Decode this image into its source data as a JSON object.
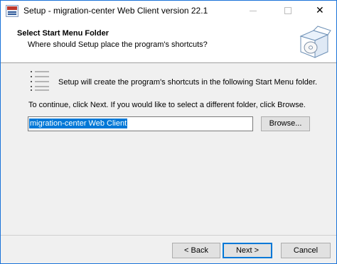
{
  "window": {
    "title": "Setup - migration-center Web Client version 22.1"
  },
  "header": {
    "title": "Select Start Menu Folder",
    "subtitle": "Where should Setup place the program's shortcuts?"
  },
  "body": {
    "intro_text": "Setup will create the program's shortcuts in the following Start Menu folder.",
    "continue_text": "To continue, click Next. If you would like to select a different folder, click Browse.",
    "folder_value": "migration-center Web Client",
    "browse_label": "Browse..."
  },
  "footer": {
    "back_label": "< Back",
    "next_label": "Next >",
    "cancel_label": "Cancel"
  },
  "icons": {
    "app": "setup-app-icon",
    "header": "software-box-disc-icon",
    "list": "list-icon"
  },
  "colors": {
    "accent": "#0078d7",
    "window_border": "#1a73d9",
    "dialog_bg": "#f0f0f0"
  }
}
